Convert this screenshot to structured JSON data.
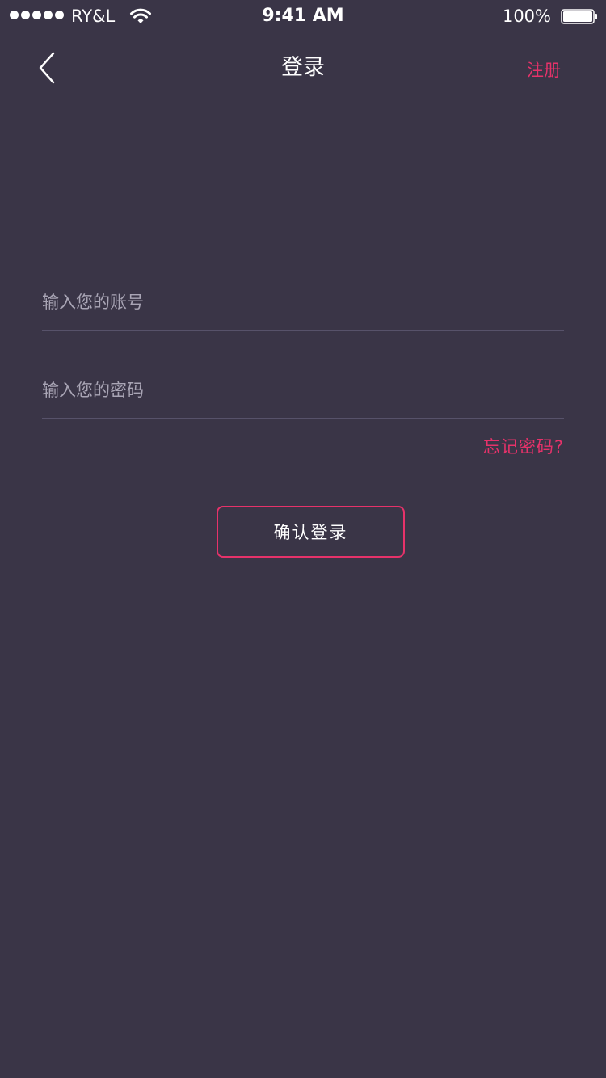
{
  "status_bar": {
    "carrier": "RY&L",
    "time": "9:41 AM",
    "battery": "100%"
  },
  "nav": {
    "title": "登录",
    "register_label": "注册",
    "back_icon": "chevron-left-icon"
  },
  "form": {
    "account_placeholder": "输入您的账号",
    "password_placeholder": "输入您的密码",
    "forgot_label": "忘记密码?",
    "confirm_label": "确认登录"
  },
  "colors": {
    "background": "#3a3547",
    "accent": "#e6326a",
    "divider": "#57526a",
    "placeholder": "#a9a5b5"
  }
}
